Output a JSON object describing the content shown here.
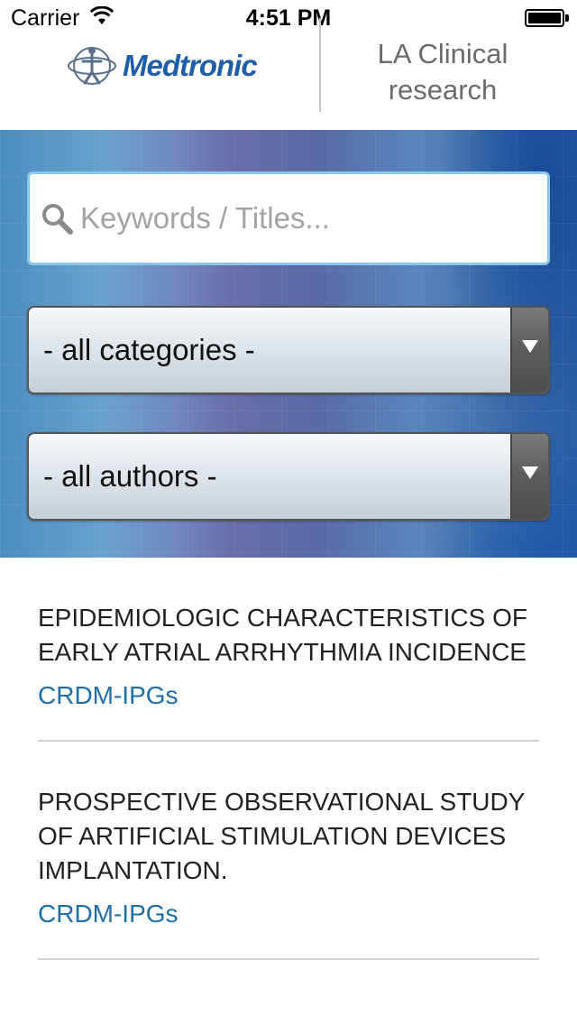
{
  "status_bar": {
    "carrier": "Carrier",
    "time": "4:51 PM",
    "icons": [
      "wifi-icon",
      "battery-icon"
    ]
  },
  "header": {
    "logo_text": "Medtronic",
    "title": "LA Clinical\nresearch"
  },
  "search": {
    "placeholder": "Keywords / Titles...",
    "value": ""
  },
  "filters": {
    "category": "- all categories -",
    "author": "- all authors -"
  },
  "results": [
    {
      "title": "EPIDEMIOLOGIC CHARACTERISTICS OF EARLY ATRIAL ARRHYTHMIA INCIDENCE",
      "category": "CRDM-IPGs"
    },
    {
      "title": "PROSPECTIVE OBSERVATIONAL STUDY OF ARTIFICIAL STIMULATION DEVICES IMPLANTATION.",
      "category": "CRDM-IPGs"
    }
  ],
  "colors": {
    "brand_blue": "#1f5fa8",
    "link_blue": "#1f6fa8",
    "panel_blue": "#4b8dc0"
  }
}
